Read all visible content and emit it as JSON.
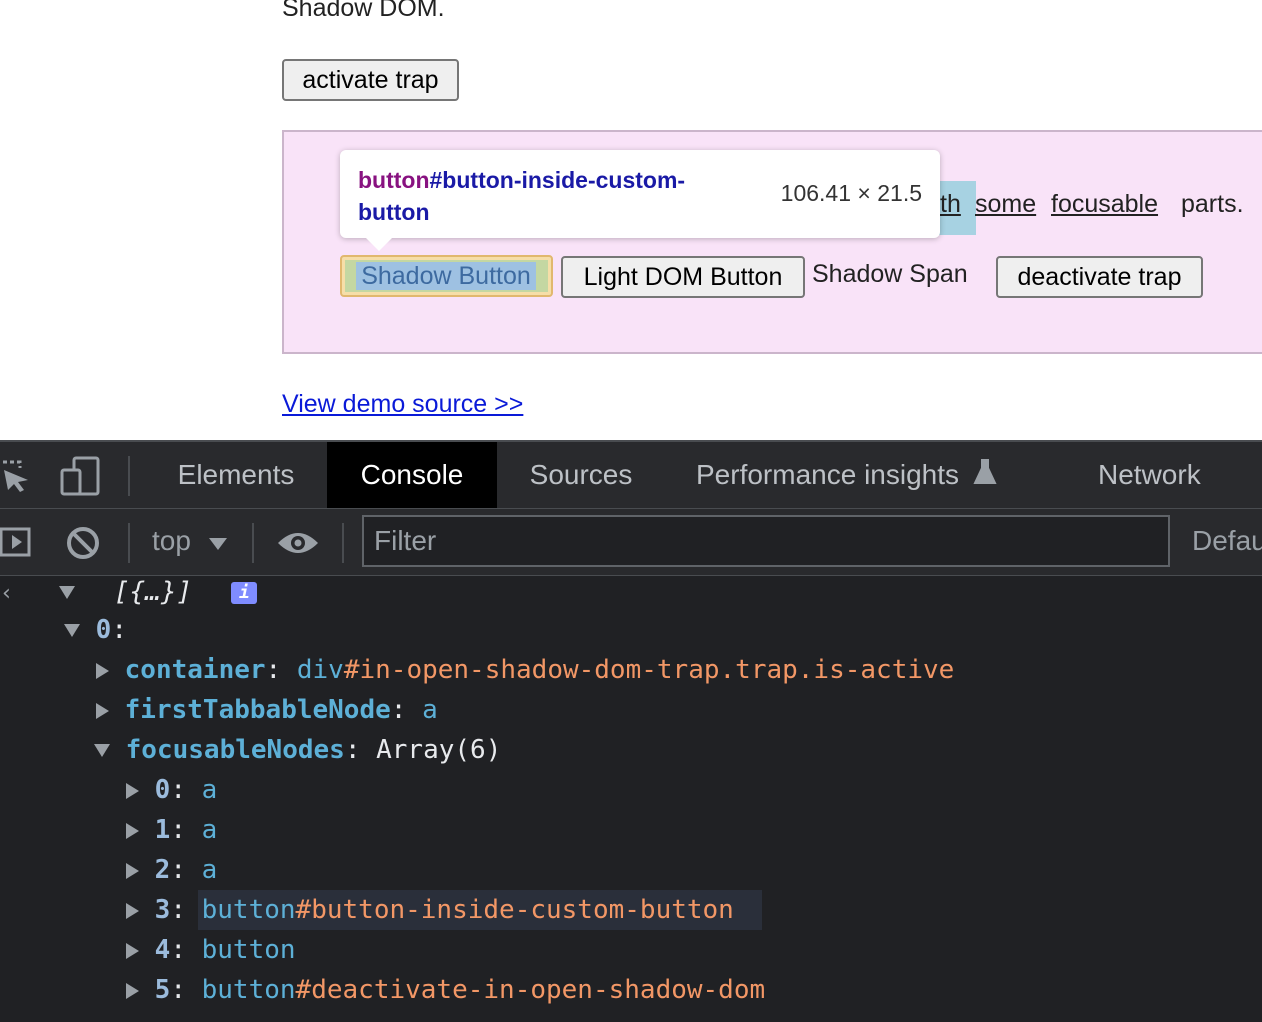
{
  "page": {
    "intro_text": "Shadow DOM.",
    "activate_button": "activate trap",
    "sentence": {
      "fragment_highlighted": "th",
      "link_some": "some",
      "link_focusable": "focusable",
      "suffix": "parts."
    },
    "shadow_button": "Shadow Button",
    "light_dom_button": "Light DOM Button",
    "shadow_span": "Shadow Span",
    "deactivate_button": "deactivate trap",
    "view_demo_link": "View demo source >>"
  },
  "tooltip": {
    "tag": "button",
    "selector": "#button-inside-custom-button",
    "size": "106.41 × 21.5"
  },
  "devtools": {
    "tabs": [
      {
        "label": "Elements"
      },
      {
        "label": "Console"
      },
      {
        "label": "Sources"
      },
      {
        "label": "Performance insights"
      },
      {
        "label": "Network"
      }
    ],
    "active_tab": "Console",
    "toolbar": {
      "context": "top",
      "filter_placeholder": "Filter",
      "levels": "Defau"
    },
    "console": {
      "summary": "[{…}]",
      "badge": "i",
      "item_index": "0",
      "container_key": "container",
      "container_tag": "div",
      "container_value": "#in-open-shadow-dom-trap.trap.is-active",
      "first_key": "firstTabbableNode",
      "first_value": "a",
      "focusable_key": "focusableNodes",
      "focusable_value": "Array(6)",
      "nodes": [
        {
          "index": "0",
          "tag": "a",
          "rest": ""
        },
        {
          "index": "1",
          "tag": "a",
          "rest": ""
        },
        {
          "index": "2",
          "tag": "a",
          "rest": ""
        },
        {
          "index": "3",
          "tag": "button",
          "rest": "#button-inside-custom-button"
        },
        {
          "index": "4",
          "tag": "button",
          "rest": ""
        },
        {
          "index": "5",
          "tag": "button",
          "rest": "#deactivate-in-open-shadow-dom"
        }
      ]
    }
  }
}
